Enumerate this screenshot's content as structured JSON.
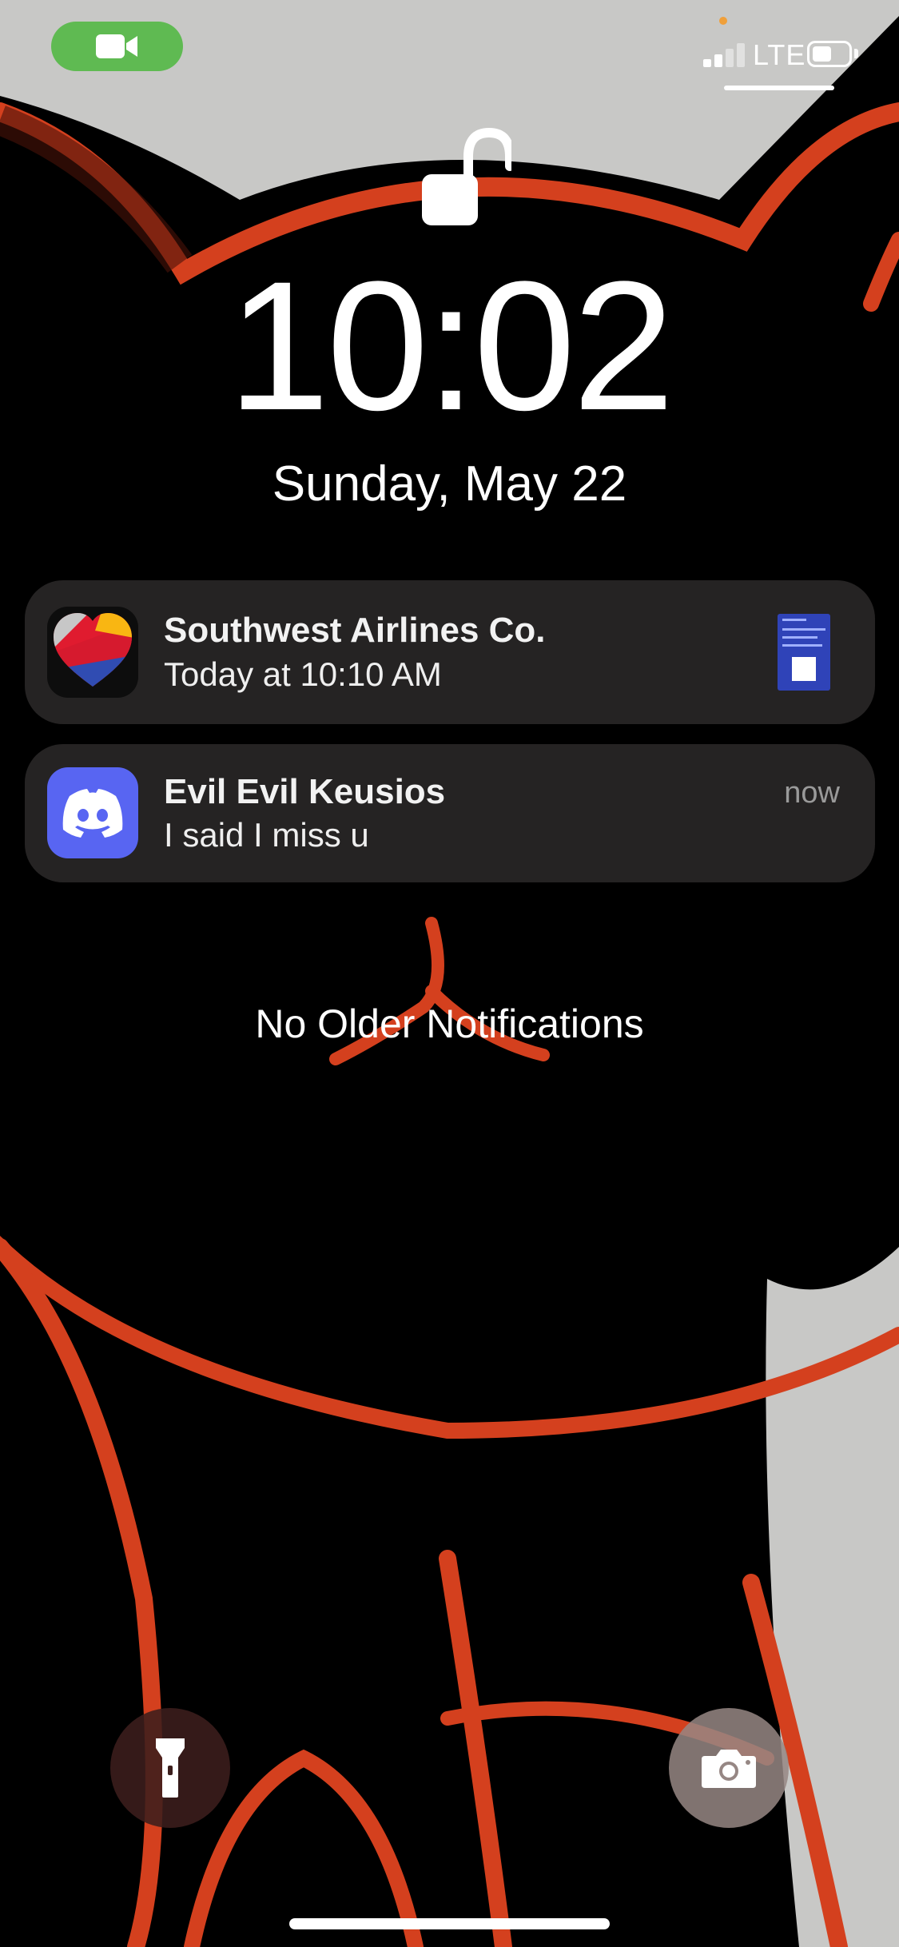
{
  "status_bar": {
    "carrier": "LTE",
    "signal_bars": 2,
    "battery_level": 0.58,
    "call_indicator_icon": "video-camera-icon",
    "call_indicator_color": "#5fba52"
  },
  "lock_screen": {
    "lock_state": "unlocked",
    "time": "10:02",
    "date": "Sunday, May 22",
    "no_older_label": "No Older Notifications"
  },
  "notifications": [
    {
      "app": "Southwest Airlines Co.",
      "body": "Today at 10:10 AM",
      "icon": "southwest-heart-icon",
      "attachment": "boarding-pass-thumbnail"
    },
    {
      "app": "Evil Evil Keusios",
      "body": "I said I miss u",
      "time": "now",
      "icon": "discord-icon",
      "icon_color": "#5865f2"
    }
  ],
  "bottom_controls": {
    "left": "flashlight-icon",
    "right": "camera-icon"
  },
  "colors": {
    "wallpaper_outline": "#d4401e",
    "wallpaper_fill": "#000000",
    "wallpaper_bg": "#c8c8c6"
  }
}
